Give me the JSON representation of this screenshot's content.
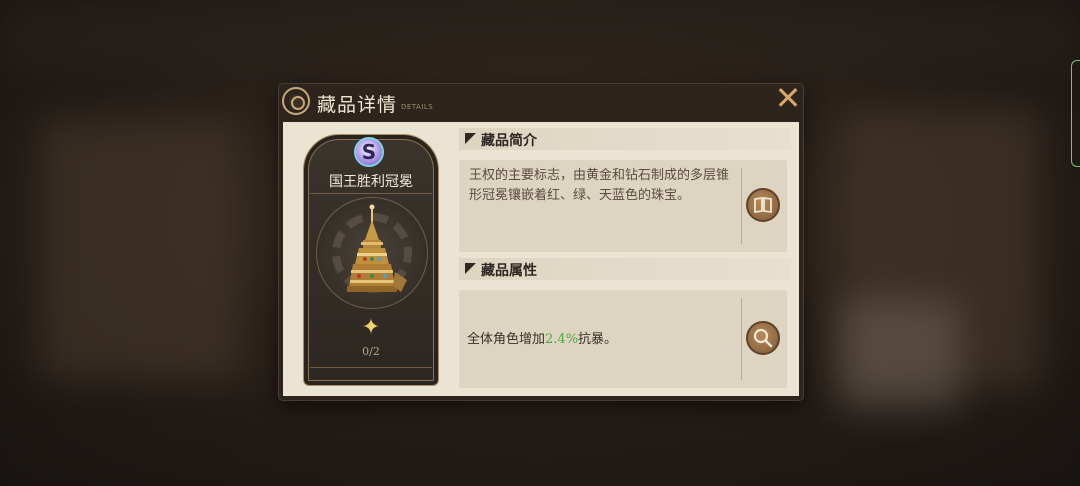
{
  "dialog": {
    "title": "藏品详情",
    "subtitle": "DETAILS",
    "close_glyph": "✕"
  },
  "item": {
    "rank": "S",
    "name": "国王胜利冠冕",
    "star_glyph": "✦",
    "progress": "0/2",
    "image_icon": "crown-icon"
  },
  "intro": {
    "heading": "藏品简介",
    "text": "王权的主要标志，由黄金和钻石制成的多层锥形冠冕镶嵌着红、绿、天蓝色的珠宝。",
    "button_icon": "book-icon"
  },
  "attributes": {
    "heading": "藏品属性",
    "prefix": "全体角色增加",
    "value": "2.4%",
    "suffix": "抗暴。",
    "button_icon": "magnifier-icon"
  },
  "colors": {
    "highlight": "#4faa3f",
    "accent_gold": "#d6a766"
  }
}
